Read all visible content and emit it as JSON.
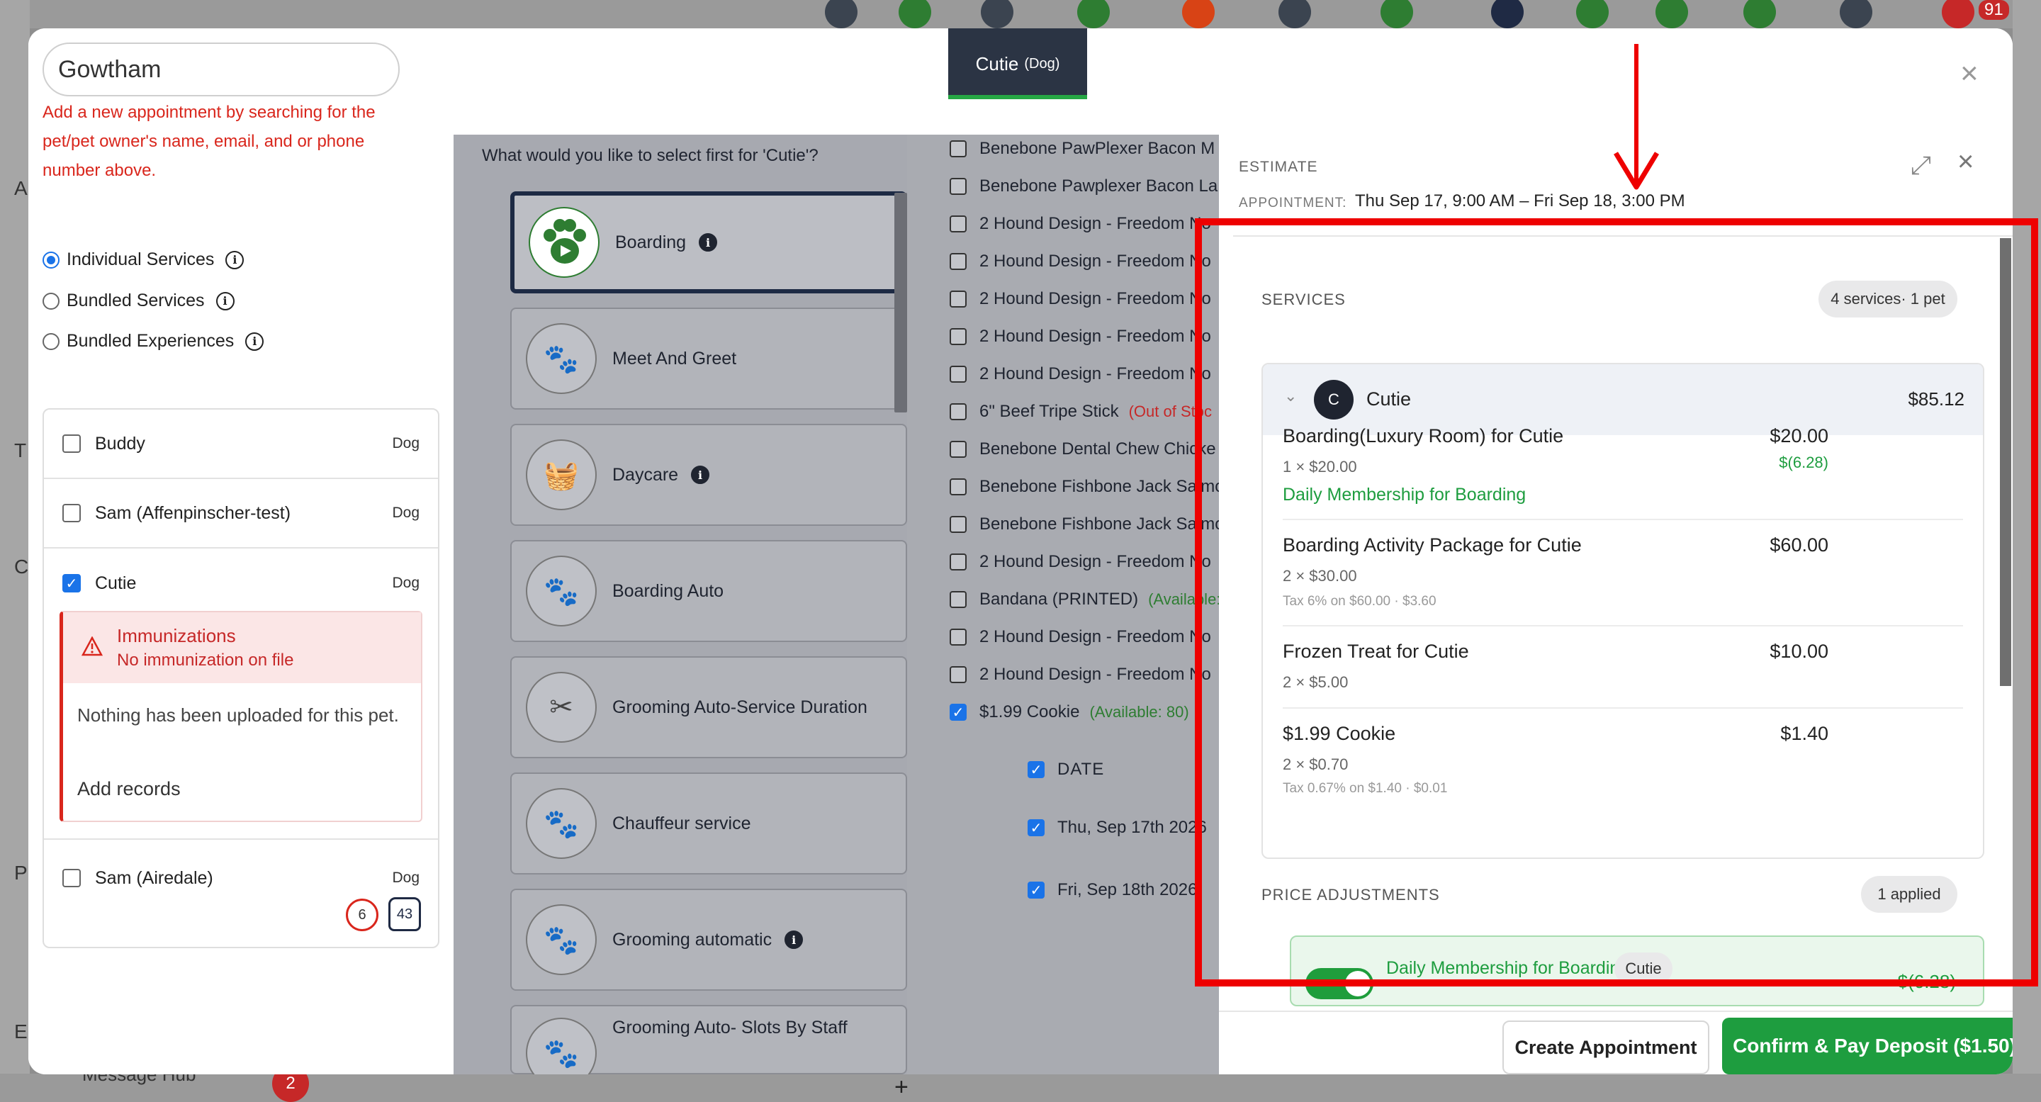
{
  "background": {
    "notification_count": "91",
    "sidebar_letters": [
      "A",
      "T",
      "C",
      "P",
      "E"
    ],
    "sidebar_badge": "2",
    "sidebar_item_label": "Message Hub"
  },
  "left": {
    "search_value": "Gowtham",
    "help_text": "Add a new appointment by searching for the pet/pet owner's name, email, and or phone number above.",
    "service_types": [
      {
        "label": "Individual Services",
        "selected": true
      },
      {
        "label": "Bundled Services",
        "selected": false
      },
      {
        "label": "Bundled Experiences",
        "selected": false
      }
    ],
    "pets": [
      {
        "name": "Buddy",
        "species": "Dog",
        "checked": false
      },
      {
        "name": "Sam (Affenpinscher-test)",
        "species": "Dog",
        "checked": false
      },
      {
        "name": "Cutie",
        "species": "Dog",
        "checked": true
      },
      {
        "name": "Sam (Airedale)",
        "species": "Dog",
        "checked": false
      }
    ],
    "immunization": {
      "title": "Immunizations",
      "subtitle": "No immunization on file",
      "body": "Nothing has been uploaded for this pet.",
      "add_records": "Add records"
    },
    "sam_badges": {
      "history": "6",
      "weight": "43"
    }
  },
  "tab": {
    "pet": "Cutie",
    "species": "(Dog)"
  },
  "services": {
    "question": "What would you like to select first for 'Cutie'?",
    "items": [
      {
        "label": "Boarding",
        "info": true,
        "selected": true,
        "icon": "paw-play-icon"
      },
      {
        "label": "Meet And Greet",
        "info": false,
        "icon": "paw-icon"
      },
      {
        "label": "Daycare",
        "info": true,
        "icon": "basket-icon"
      },
      {
        "label": "Boarding Auto",
        "info": false,
        "icon": "paw-icon"
      },
      {
        "label": "Grooming Auto-Service Duration",
        "info": false,
        "icon": "grooming-icon"
      },
      {
        "label": "Chauffeur service",
        "info": false,
        "icon": "paw-icon"
      },
      {
        "label": "Grooming automatic",
        "info": true,
        "icon": "paw-icon"
      },
      {
        "label": "Grooming Auto- Slots By Staff",
        "info": false,
        "icon": "paw-icon"
      }
    ]
  },
  "products": [
    {
      "label": "Benebone PawPlexer Bacon M",
      "checked": false,
      "note": ""
    },
    {
      "label": "Benebone Pawplexer Bacon La",
      "checked": false,
      "note": ""
    },
    {
      "label": "2 Hound Design - Freedom No",
      "checked": false,
      "note": ""
    },
    {
      "label": "2 Hound Design - Freedom No",
      "checked": false,
      "note": ""
    },
    {
      "label": "2 Hound Design - Freedom No",
      "checked": false,
      "note": ""
    },
    {
      "label": "2 Hound Design - Freedom No",
      "checked": false,
      "note": ""
    },
    {
      "label": "2 Hound Design - Freedom No",
      "checked": false,
      "note": ""
    },
    {
      "label": "6\" Beef Tripe Stick",
      "checked": false,
      "note": "(Out of Stoc"
    },
    {
      "label": "Benebone Dental Chew Chicke",
      "checked": false,
      "note": ""
    },
    {
      "label": "Benebone Fishbone Jack Salmo",
      "checked": false,
      "note": ""
    },
    {
      "label": "Benebone Fishbone Jack Salmo",
      "checked": false,
      "note": ""
    },
    {
      "label": "2 Hound Design - Freedom No",
      "checked": false,
      "note": ""
    },
    {
      "label": "Bandana (PRINTED)",
      "checked": false,
      "note": "(Available:"
    },
    {
      "label": "2 Hound Design - Freedom No",
      "checked": false,
      "note": ""
    },
    {
      "label": "2 Hound Design - Freedom No",
      "checked": false,
      "note": ""
    },
    {
      "label": "$1.99 Cookie",
      "checked": true,
      "note": "(Available: 80)"
    }
  ],
  "dates": {
    "header": "DATE",
    "items": [
      "Thu, Sep 17th 2026",
      "Fri, Sep 18th 2026"
    ]
  },
  "estimate": {
    "title": "ESTIMATE",
    "appointment_label": "APPOINTMENT:",
    "appointment_value": "Thu Sep 17, 9:00 AM – Fri Sep 18, 3:00 PM",
    "services_label": "SERVICES",
    "services_summary": "4 services· 1 pet",
    "pet_initial": "C",
    "pet_name": "Cutie",
    "pet_total": "$85.12",
    "line_items": [
      {
        "name": "Boarding(Luxury Room) for Cutie",
        "qty": "1 × $20.00",
        "price": "$20.00",
        "discount": "$(6.28)",
        "membership": "Daily Membership for Boarding",
        "tax": ""
      },
      {
        "name": "Boarding Activity Package for Cutie",
        "qty": "2 × $30.00",
        "price": "$60.00",
        "discount": "",
        "membership": "",
        "tax": "Tax 6% on $60.00 · $3.60"
      },
      {
        "name": "Frozen Treat for Cutie",
        "qty": "2 × $5.00",
        "price": "$10.00",
        "discount": "",
        "membership": "",
        "tax": ""
      },
      {
        "name": "$1.99 Cookie",
        "qty": "2 × $0.70",
        "price": "$1.40",
        "discount": "",
        "membership": "",
        "tax": "Tax 0.67% on $1.40 · $0.01"
      }
    ],
    "adjustments_label": "PRICE ADJUSTMENTS",
    "adjustments_summary": "1 applied",
    "adjustment": {
      "name": "Daily Membership for Boarding",
      "pet": "Cutie",
      "amount": "$(6.28)",
      "enabled": true
    }
  },
  "actions": {
    "create": "Create Appointment",
    "confirm": "Confirm & Pay Deposit ($1.50)"
  },
  "colors": {
    "accent_green": "#1e9d3f",
    "error_red": "#d9261c",
    "annotation_red": "#ee0000",
    "tab_dark": "#2b3444"
  }
}
